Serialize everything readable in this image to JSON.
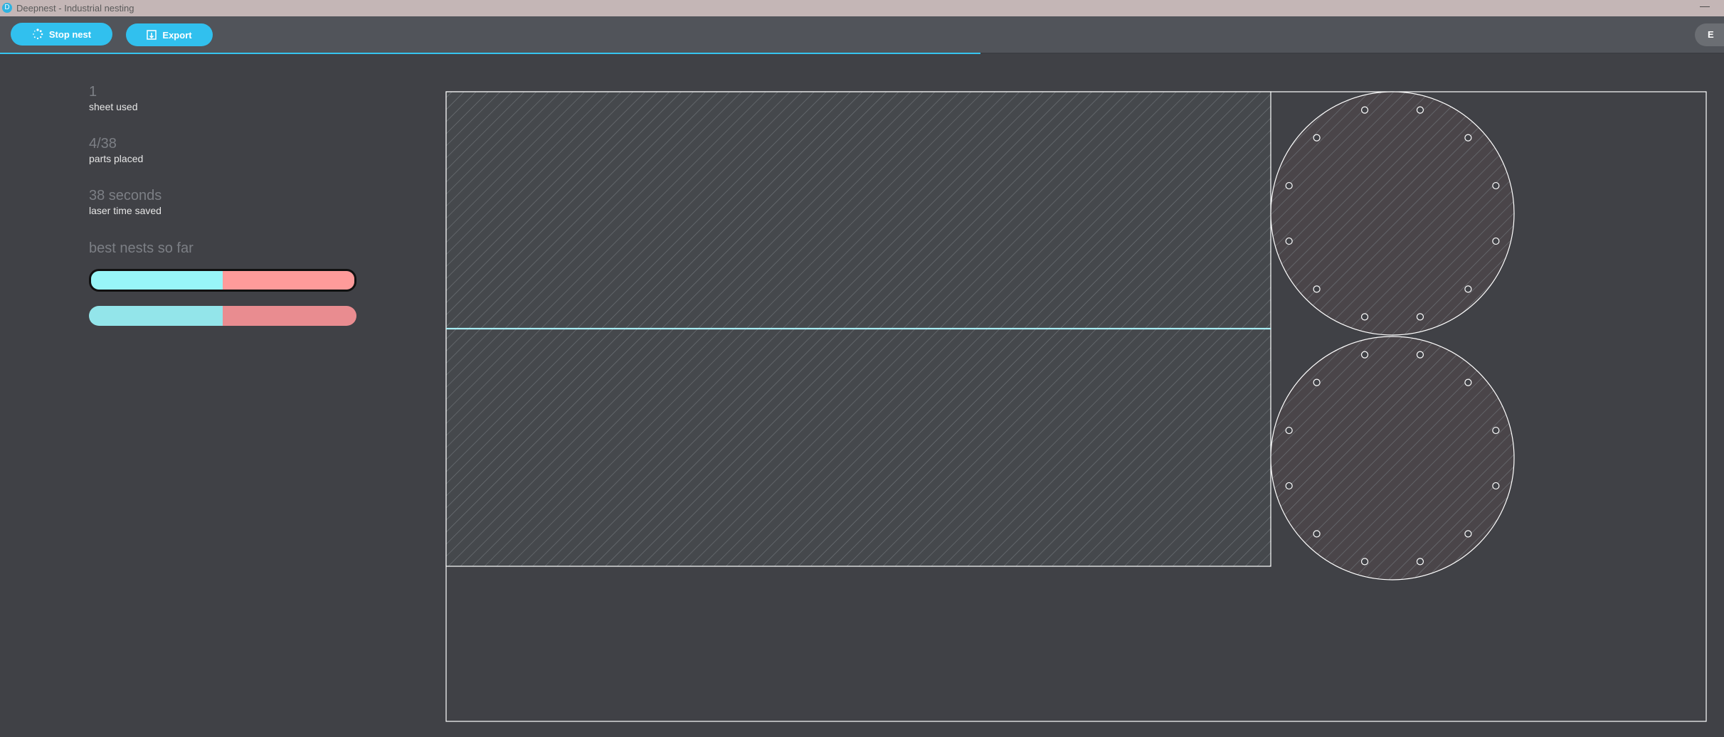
{
  "window": {
    "title": "Deepnest - Industrial nesting",
    "minimize_glyph": "—"
  },
  "toolbar": {
    "stop_label": "Stop nest",
    "export_label": "Export",
    "right_label": "E",
    "progress_fraction": 0.5,
    "accent_color": "#31c0ee"
  },
  "stats": {
    "sheets_value": "1",
    "sheets_label": "sheet used",
    "parts_value": "4/38",
    "parts_label": "parts placed",
    "time_value": "38 seconds",
    "time_label": "laser time saved",
    "best_title": "best nests so far"
  },
  "best_nests": [
    {
      "fill_fraction": 0.5,
      "selected": true
    },
    {
      "fill_fraction": 0.5,
      "selected": false
    }
  ],
  "icons": {
    "stop": "spinner-icon",
    "export": "export-icon",
    "app": "deepnest-logo-icon"
  },
  "colors": {
    "background": "#404146",
    "part_stroke": "#ffffff",
    "highlight_edge": "#a8eef5"
  }
}
